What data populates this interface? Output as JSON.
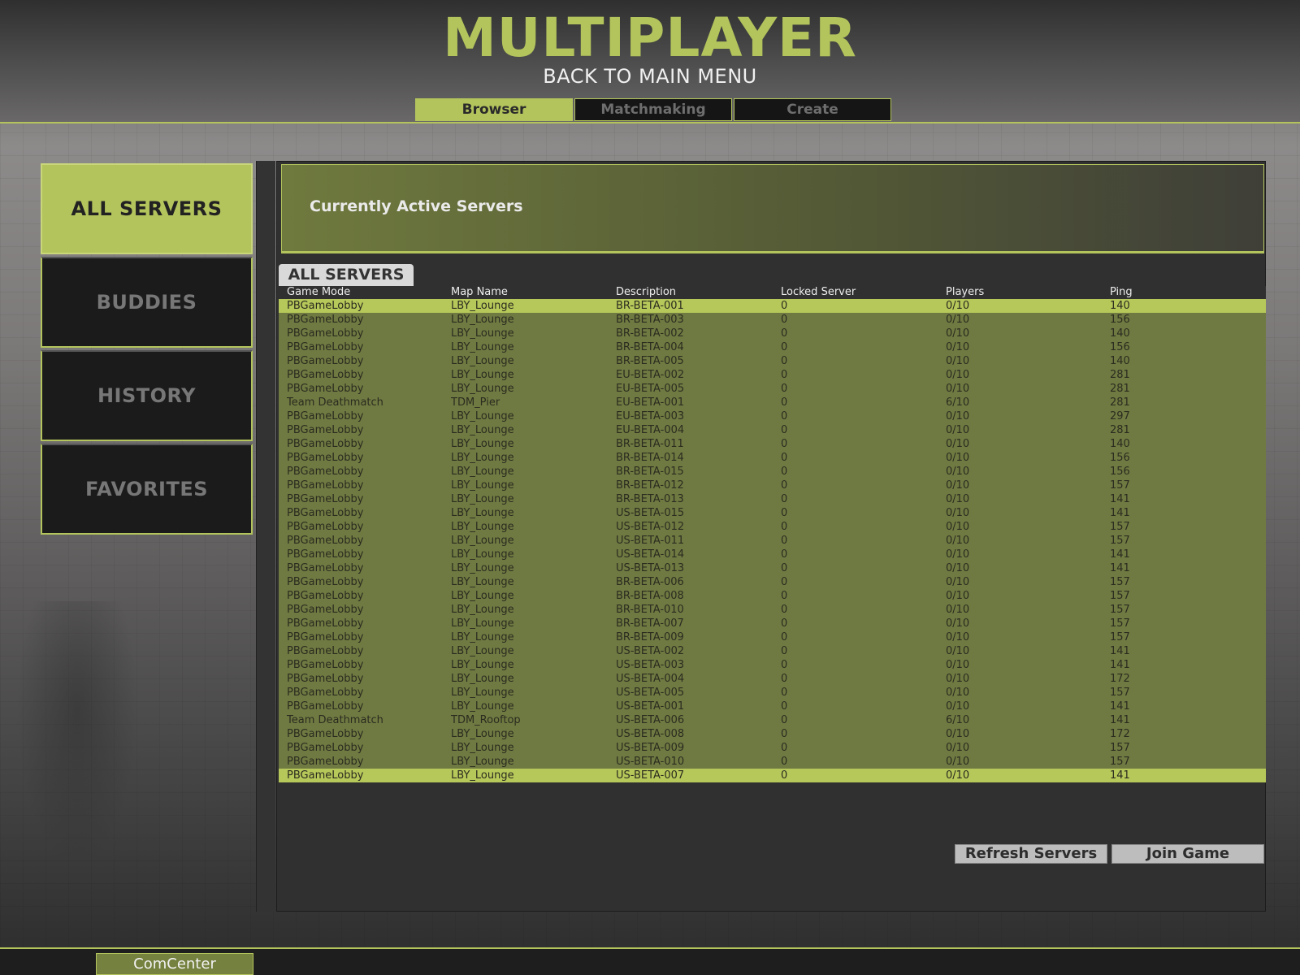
{
  "header": {
    "title": "MULTIPLAYER",
    "back_label": "BACK TO MAIN MENU",
    "tabs": [
      {
        "label": "Browser",
        "active": true
      },
      {
        "label": "Matchmaking",
        "active": false
      },
      {
        "label": "Create",
        "active": false
      }
    ]
  },
  "sidebar": {
    "items": [
      {
        "label": "ALL SERVERS",
        "active": true
      },
      {
        "label": "BUDDIES",
        "active": false
      },
      {
        "label": "HISTORY",
        "active": false
      },
      {
        "label": "FAVORITES",
        "active": false
      }
    ]
  },
  "panel": {
    "header_text": "Currently Active Servers",
    "list_tab": "ALL SERVERS",
    "columns": [
      "Game Mode",
      "Map Name",
      "Description",
      "Locked Server",
      "Players",
      "Ping"
    ]
  },
  "servers": [
    {
      "mode": "PBGameLobby",
      "map": "LBY_Lounge",
      "desc": "BR-BETA-001",
      "locked": "0",
      "players": "0/10",
      "ping": "140",
      "selected": true
    },
    {
      "mode": "PBGameLobby",
      "map": "LBY_Lounge",
      "desc": "BR-BETA-003",
      "locked": "0",
      "players": "0/10",
      "ping": "156"
    },
    {
      "mode": "PBGameLobby",
      "map": "LBY_Lounge",
      "desc": "BR-BETA-002",
      "locked": "0",
      "players": "0/10",
      "ping": "140"
    },
    {
      "mode": "PBGameLobby",
      "map": "LBY_Lounge",
      "desc": "BR-BETA-004",
      "locked": "0",
      "players": "0/10",
      "ping": "156"
    },
    {
      "mode": "PBGameLobby",
      "map": "LBY_Lounge",
      "desc": "BR-BETA-005",
      "locked": "0",
      "players": "0/10",
      "ping": "140"
    },
    {
      "mode": "PBGameLobby",
      "map": "LBY_Lounge",
      "desc": "EU-BETA-002",
      "locked": "0",
      "players": "0/10",
      "ping": "281"
    },
    {
      "mode": "PBGameLobby",
      "map": "LBY_Lounge",
      "desc": "EU-BETA-005",
      "locked": "0",
      "players": "0/10",
      "ping": "281"
    },
    {
      "mode": "Team Deathmatch",
      "map": "TDM_Pier",
      "desc": "EU-BETA-001",
      "locked": "0",
      "players": "6/10",
      "ping": "281"
    },
    {
      "mode": "PBGameLobby",
      "map": "LBY_Lounge",
      "desc": "EU-BETA-003",
      "locked": "0",
      "players": "0/10",
      "ping": "297"
    },
    {
      "mode": "PBGameLobby",
      "map": "LBY_Lounge",
      "desc": "EU-BETA-004",
      "locked": "0",
      "players": "0/10",
      "ping": "281"
    },
    {
      "mode": "PBGameLobby",
      "map": "LBY_Lounge",
      "desc": "BR-BETA-011",
      "locked": "0",
      "players": "0/10",
      "ping": "140"
    },
    {
      "mode": "PBGameLobby",
      "map": "LBY_Lounge",
      "desc": "BR-BETA-014",
      "locked": "0",
      "players": "0/10",
      "ping": "156"
    },
    {
      "mode": "PBGameLobby",
      "map": "LBY_Lounge",
      "desc": "BR-BETA-015",
      "locked": "0",
      "players": "0/10",
      "ping": "156"
    },
    {
      "mode": "PBGameLobby",
      "map": "LBY_Lounge",
      "desc": "BR-BETA-012",
      "locked": "0",
      "players": "0/10",
      "ping": "157"
    },
    {
      "mode": "PBGameLobby",
      "map": "LBY_Lounge",
      "desc": "BR-BETA-013",
      "locked": "0",
      "players": "0/10",
      "ping": "141"
    },
    {
      "mode": "PBGameLobby",
      "map": "LBY_Lounge",
      "desc": "US-BETA-015",
      "locked": "0",
      "players": "0/10",
      "ping": "141"
    },
    {
      "mode": "PBGameLobby",
      "map": "LBY_Lounge",
      "desc": "US-BETA-012",
      "locked": "0",
      "players": "0/10",
      "ping": "157"
    },
    {
      "mode": "PBGameLobby",
      "map": "LBY_Lounge",
      "desc": "US-BETA-011",
      "locked": "0",
      "players": "0/10",
      "ping": "157"
    },
    {
      "mode": "PBGameLobby",
      "map": "LBY_Lounge",
      "desc": "US-BETA-014",
      "locked": "0",
      "players": "0/10",
      "ping": "141"
    },
    {
      "mode": "PBGameLobby",
      "map": "LBY_Lounge",
      "desc": "US-BETA-013",
      "locked": "0",
      "players": "0/10",
      "ping": "141"
    },
    {
      "mode": "PBGameLobby",
      "map": "LBY_Lounge",
      "desc": "BR-BETA-006",
      "locked": "0",
      "players": "0/10",
      "ping": "157"
    },
    {
      "mode": "PBGameLobby",
      "map": "LBY_Lounge",
      "desc": "BR-BETA-008",
      "locked": "0",
      "players": "0/10",
      "ping": "157"
    },
    {
      "mode": "PBGameLobby",
      "map": "LBY_Lounge",
      "desc": "BR-BETA-010",
      "locked": "0",
      "players": "0/10",
      "ping": "157"
    },
    {
      "mode": "PBGameLobby",
      "map": "LBY_Lounge",
      "desc": "BR-BETA-007",
      "locked": "0",
      "players": "0/10",
      "ping": "157"
    },
    {
      "mode": "PBGameLobby",
      "map": "LBY_Lounge",
      "desc": "BR-BETA-009",
      "locked": "0",
      "players": "0/10",
      "ping": "157"
    },
    {
      "mode": "PBGameLobby",
      "map": "LBY_Lounge",
      "desc": "US-BETA-002",
      "locked": "0",
      "players": "0/10",
      "ping": "141"
    },
    {
      "mode": "PBGameLobby",
      "map": "LBY_Lounge",
      "desc": "US-BETA-003",
      "locked": "0",
      "players": "0/10",
      "ping": "141"
    },
    {
      "mode": "PBGameLobby",
      "map": "LBY_Lounge",
      "desc": "US-BETA-004",
      "locked": "0",
      "players": "0/10",
      "ping": "172"
    },
    {
      "mode": "PBGameLobby",
      "map": "LBY_Lounge",
      "desc": "US-BETA-005",
      "locked": "0",
      "players": "0/10",
      "ping": "157"
    },
    {
      "mode": "PBGameLobby",
      "map": "LBY_Lounge",
      "desc": "US-BETA-001",
      "locked": "0",
      "players": "0/10",
      "ping": "141"
    },
    {
      "mode": "Team Deathmatch",
      "map": "TDM_Rooftop",
      "desc": "US-BETA-006",
      "locked": "0",
      "players": "6/10",
      "ping": "141"
    },
    {
      "mode": "PBGameLobby",
      "map": "LBY_Lounge",
      "desc": "US-BETA-008",
      "locked": "0",
      "players": "0/10",
      "ping": "172"
    },
    {
      "mode": "PBGameLobby",
      "map": "LBY_Lounge",
      "desc": "US-BETA-009",
      "locked": "0",
      "players": "0/10",
      "ping": "157"
    },
    {
      "mode": "PBGameLobby",
      "map": "LBY_Lounge",
      "desc": "US-BETA-010",
      "locked": "0",
      "players": "0/10",
      "ping": "157"
    },
    {
      "mode": "PBGameLobby",
      "map": "LBY_Lounge",
      "desc": "US-BETA-007",
      "locked": "0",
      "players": "0/10",
      "ping": "141",
      "selected": true
    }
  ],
  "actions": {
    "refresh_label": "Refresh Servers",
    "join_label": "Join Game"
  },
  "footer": {
    "comcenter_label": "ComCenter"
  },
  "colors": {
    "accent": "#b3c45c",
    "table_bg": "#6f7a42",
    "panel_bg": "#303030"
  }
}
